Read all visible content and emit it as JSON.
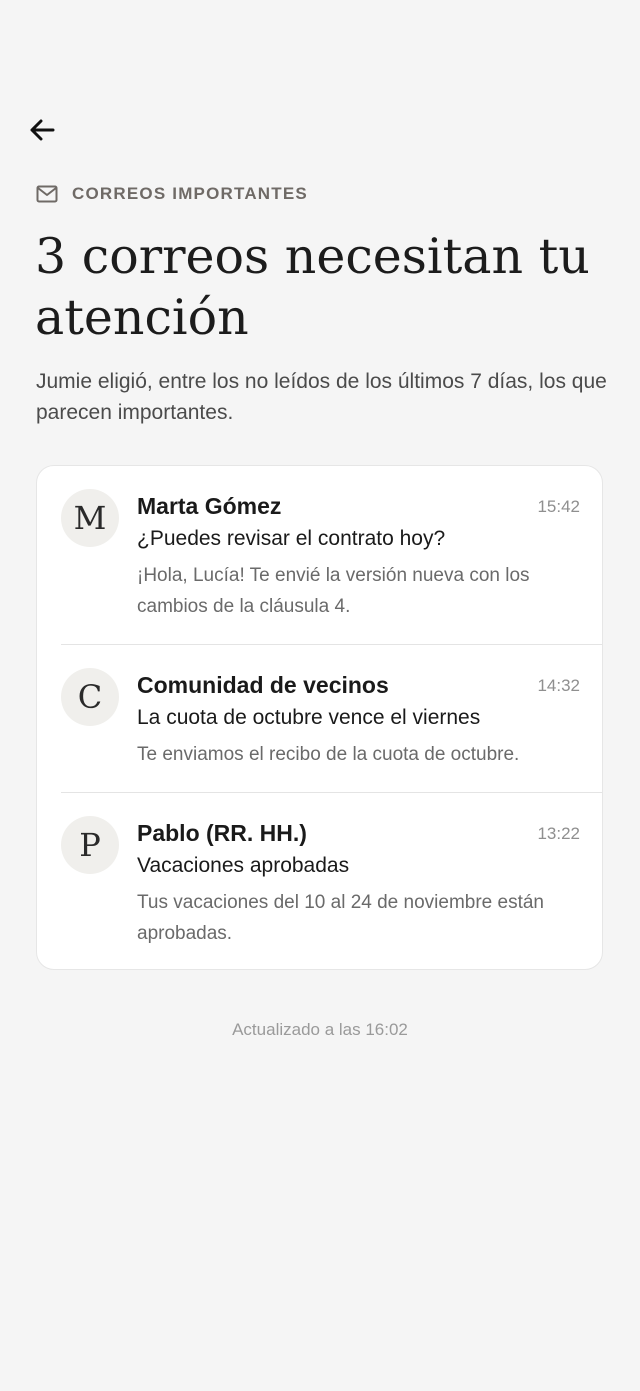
{
  "nav": {
    "back_icon": "arrow-left-icon"
  },
  "header": {
    "eyebrow_icon": "mail-icon",
    "eyebrow_label": "CORREOS IMPORTANTES",
    "title": "3 correos necesitan tu atención",
    "subtitle": "Jumie eligió, entre los no leídos de los últimos 7 días, los que parecen importantes."
  },
  "emails": [
    {
      "initial": "M",
      "sender": "Marta Gómez",
      "time": "15:42",
      "subject": "¿Puedes revisar el contrato hoy?",
      "preview": "¡Hola, Lucía! Te envié la versión nueva con los cambios de la cláusula 4."
    },
    {
      "initial": "C",
      "sender": "Comunidad de vecinos",
      "time": "14:32",
      "subject": "La cuota de octubre vence el viernes",
      "preview": "Te enviamos el recibo de la cuota de octubre."
    },
    {
      "initial": "P",
      "sender": "Pablo (RR. HH.)",
      "time": "13:22",
      "subject": "Vacaciones aprobadas",
      "preview": "Tus vacaciones del 10 al 24 de noviembre están aprobadas."
    }
  ],
  "footer": {
    "updated": "Actualizado a las 16:02"
  }
}
